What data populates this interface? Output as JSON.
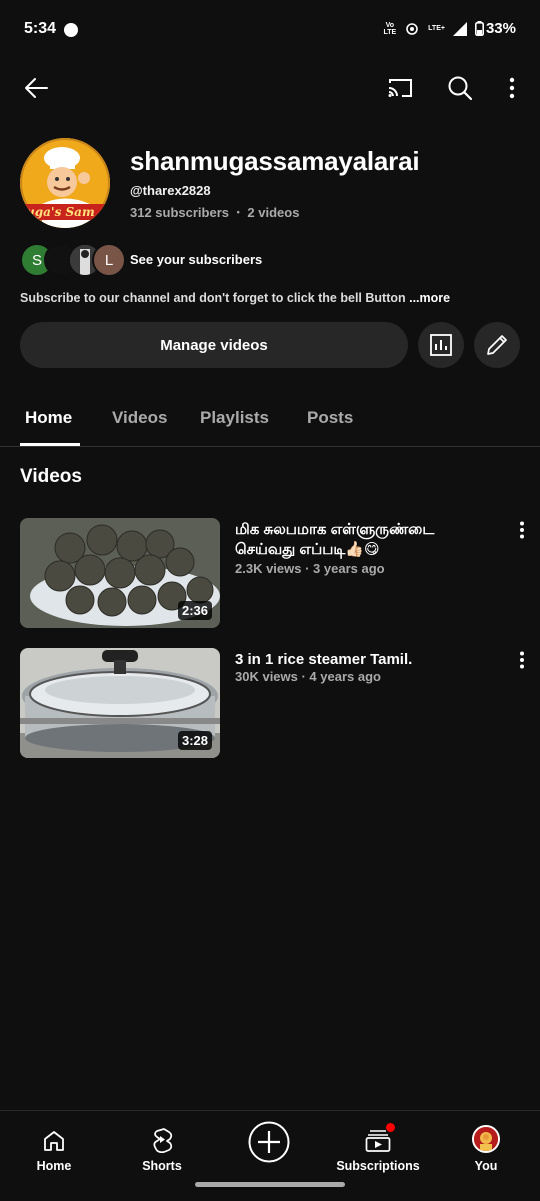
{
  "status_bar": {
    "time": "5:34",
    "network_label_1": "Vo¹\nLTE",
    "network_label_2": "LTE+",
    "battery": "33%"
  },
  "channel": {
    "name": "shanmugassamayalarai",
    "handle": "@tharex2828",
    "subscribers": "312 subscribers",
    "videos_count": "2 videos",
    "separator": "•",
    "avatar_text": "uga's Sam",
    "see_subscribers": "See your subscribers",
    "subscriber_avatars": [
      "S",
      "",
      "",
      "L"
    ],
    "description": "Subscribe to our channel and don't forget to click the bell Button ",
    "more": "...more",
    "manage_button": "Manage videos"
  },
  "tabs": [
    {
      "label": "Home",
      "active": true
    },
    {
      "label": "Videos",
      "active": false
    },
    {
      "label": "Playlists",
      "active": false
    },
    {
      "label": "Posts",
      "active": false
    }
  ],
  "section": {
    "title": "Videos"
  },
  "videos": [
    {
      "title": "மிக சுலபமாக எள்ளுருண்டை செய்வது எப்படி👍🏻😋",
      "meta": "2.3K views · 3 years ago",
      "duration": "2:36"
    },
    {
      "title": "3 in 1 rice steamer Tamil.",
      "meta": "30K views · 4 years ago",
      "duration": "3:28"
    }
  ],
  "bottom_nav": [
    {
      "label": "Home",
      "icon": "home-icon"
    },
    {
      "label": "Shorts",
      "icon": "shorts-icon"
    },
    {
      "label": "",
      "icon": "create-icon"
    },
    {
      "label": "Subscriptions",
      "icon": "subscriptions-icon"
    },
    {
      "label": "You",
      "icon": "you-avatar"
    }
  ],
  "colors": {
    "background": "#0f0f0f",
    "button_bg": "#272727",
    "notification_dot": "#ff0000",
    "muted_text": "#aaaaaa"
  }
}
